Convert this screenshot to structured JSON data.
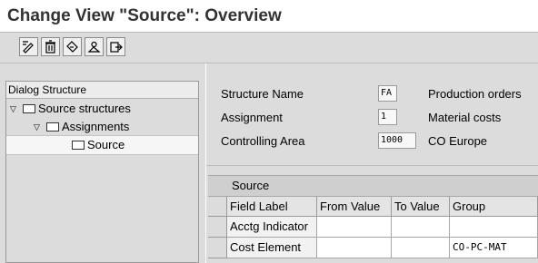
{
  "title": "Change View \"Source\": Overview",
  "toolbar": {
    "buttons": [
      {
        "name": "change-display-icon"
      },
      {
        "name": "delete-icon"
      },
      {
        "name": "undo-icon"
      },
      {
        "name": "select-all-icon"
      },
      {
        "name": "export-icon"
      }
    ]
  },
  "dialog_structure": {
    "header": "Dialog Structure",
    "items": [
      {
        "label": "Source structures",
        "expanded": true
      },
      {
        "label": "Assignments",
        "expanded": true
      },
      {
        "label": "Source",
        "selected": true
      }
    ]
  },
  "form": {
    "structure_name": {
      "label": "Structure Name",
      "value": "FA",
      "description": "Production orders"
    },
    "assignment": {
      "label": "Assignment",
      "value": "1",
      "description": "Material costs"
    },
    "controlling_area": {
      "label": "Controlling Area",
      "value": "1000",
      "description": "CO Europe"
    }
  },
  "table": {
    "title": "Source",
    "columns": [
      "Field Label",
      "From Value",
      "To Value",
      "Group"
    ],
    "rows": [
      {
        "field_label": "Acctg Indicator",
        "from_value": "",
        "to_value": "",
        "group": ""
      },
      {
        "field_label": "Cost Element",
        "from_value": "",
        "to_value": "",
        "group": "CO-PC-MAT"
      }
    ]
  }
}
